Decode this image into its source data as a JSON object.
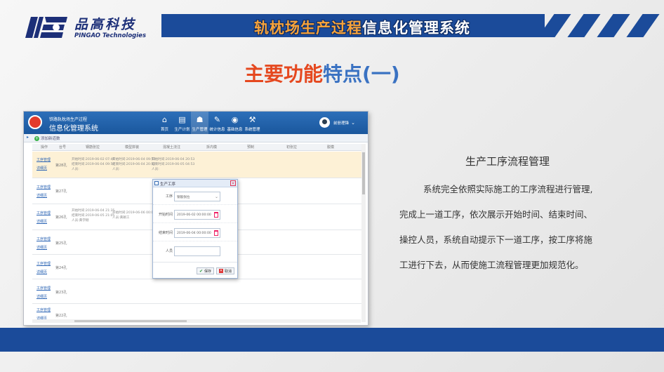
{
  "brand": {
    "name_cn": "品高科技",
    "name_en": "PINGAO Technologies",
    "color": "#1c2f78"
  },
  "header": {
    "title_part1": "轨枕场生产过程",
    "title_part2": "信息化管理系统",
    "bar_color": "#1b4b9a"
  },
  "heading": {
    "part1": "主要功能",
    "part2": "特点(一)"
  },
  "app": {
    "title_small": "铁路轨枕场生产过程",
    "title_large": "信息化管理系统",
    "nav": [
      {
        "label": "首页",
        "icon": "home-icon"
      },
      {
        "label": "生产计划",
        "icon": "document-icon"
      },
      {
        "label": "生产管理",
        "icon": "people-icon"
      },
      {
        "label": "统计信息",
        "icon": "chart-icon"
      },
      {
        "label": "基础信息",
        "icon": "database-icon"
      },
      {
        "label": "系统管理",
        "icon": "tools-icon"
      }
    ],
    "user": "前册理锋",
    "add_label": "添加新道数",
    "columns": [
      "操作",
      "台号",
      "钢筋张拉",
      "模型拼装",
      "混凝土浇注",
      "拆内模",
      "预制",
      "初张拉",
      "脱模"
    ],
    "link_edit": "工序管理",
    "link_view": "详细页",
    "rows": [
      {
        "no": "第28孔",
        "c1": [
          "开始时间:2019-06-02 07:46",
          "结束时间:2019-06-04 09:50",
          "人员:"
        ],
        "c2": [
          "开始时间:2019-06-04 09:52",
          "结束时间:2019-06-04 20:52",
          "人员:"
        ],
        "c3": [
          "开始时间:2019-06-04 20:53",
          "结束时间:2019-06-05 04:53",
          "人员:"
        ]
      },
      {
        "no": "第27孔",
        "c1": [],
        "c2": [],
        "c3": []
      },
      {
        "no": "第26孔",
        "c1": [
          "开始时间:2019-06-04 21:35",
          "结束时间:2019-06-05 21:05",
          "人员:黄学刚"
        ],
        "c2": [
          "开始时间:2019-06-06 00:00",
          "人员:黄颖工"
        ],
        "c3": []
      },
      {
        "no": "第25孔",
        "c1": [],
        "c2": [],
        "c3": []
      },
      {
        "no": "第24孔",
        "c1": [],
        "c2": [],
        "c3": []
      },
      {
        "no": "第23孔",
        "c1": [],
        "c2": [],
        "c3": []
      },
      {
        "no": "第22孔",
        "c1": [],
        "c2": [],
        "c3": []
      }
    ],
    "dialog": {
      "title": "生产工序",
      "fields": [
        {
          "label": "工序",
          "value": "钢筋张拉"
        },
        {
          "label": "开始时间",
          "value": "2019-06-02 00:00:00"
        },
        {
          "label": "结束时间",
          "value": "2019-06-04 00:00:00"
        },
        {
          "label": "人员",
          "value": ""
        }
      ],
      "save_label": "保存",
      "cancel_label": "取消"
    }
  },
  "feature": {
    "title": "生产工序流程管理",
    "lines": [
      "系统完全依照实际施工的工序流程进行管理,",
      "完成上一道工序，依次展示开始时间、结束时间、",
      "操控人员，系统自动提示下一道工序，按工序将施",
      "工进行下去，从而使施工流程管理更加规范化。"
    ]
  }
}
